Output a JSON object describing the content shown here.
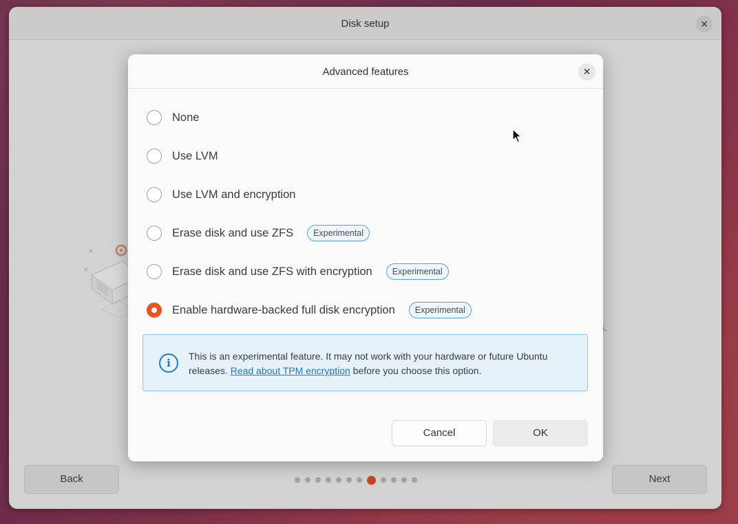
{
  "window": {
    "title": "Disk setup",
    "close_glyph": "✕",
    "back_label": "Back",
    "next_label": "Next",
    "partial_text": "s.",
    "pager": {
      "total": 12,
      "active_index": 7
    }
  },
  "dialog": {
    "title": "Advanced features",
    "close_glyph": "✕",
    "options": [
      {
        "label": "None",
        "checked": false,
        "badge": ""
      },
      {
        "label": "Use LVM",
        "checked": false,
        "badge": ""
      },
      {
        "label": "Use LVM and encryption",
        "checked": false,
        "badge": ""
      },
      {
        "label": "Erase disk and use ZFS",
        "checked": false,
        "badge": "Experimental"
      },
      {
        "label": "Erase disk and use ZFS with encryption",
        "checked": false,
        "badge": "Experimental"
      },
      {
        "label": "Enable hardware-backed full disk encryption",
        "checked": true,
        "badge": "Experimental"
      }
    ],
    "info": {
      "icon": "info-icon",
      "icon_glyph": "i",
      "text_before": "This is an experimental feature. It may not work with your hardware or future Ubuntu releases. ",
      "link_text": "Read about TPM encryption",
      "text_after": " before you choose this option."
    },
    "cancel_label": "Cancel",
    "ok_label": "OK"
  },
  "colors": {
    "accent": "#e95420",
    "link": "#1c78bf",
    "badge_border": "#5aa0cf",
    "info_border": "#8cc3e6"
  }
}
